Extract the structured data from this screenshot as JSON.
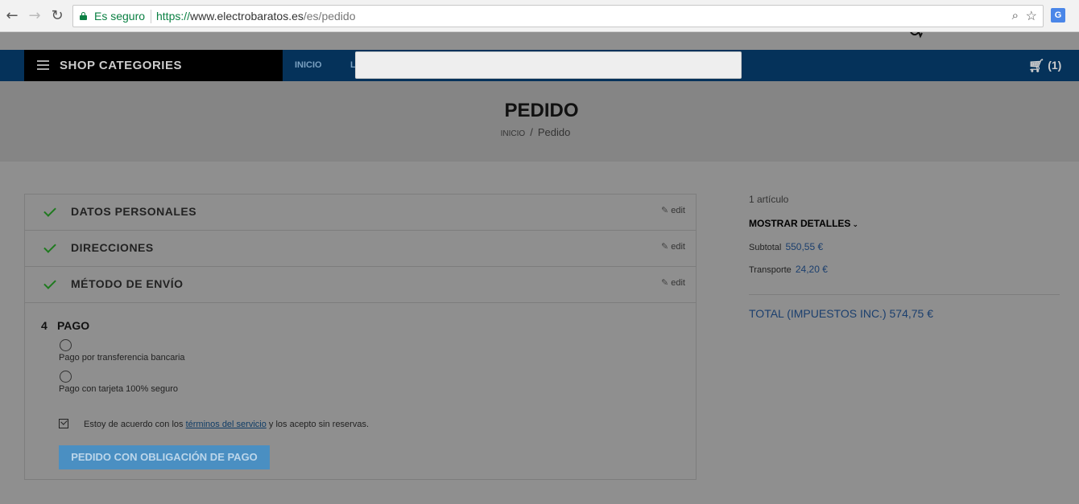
{
  "browser": {
    "secure_label": "Es seguro",
    "url_scheme": "https://",
    "url_host": "www.electrobaratos.es",
    "url_path": "/es/pedido"
  },
  "nav": {
    "shop_categories": "SHOP CATEGORIES",
    "link_inicio": "INICIO",
    "link_l": "L",
    "cart_count": "(1)"
  },
  "page": {
    "title": "PEDIDO",
    "breadcrumb_home": "Inicio",
    "breadcrumb_sep": "/",
    "breadcrumb_current": "Pedido"
  },
  "steps": [
    {
      "title": "DATOS PERSONALES",
      "edit": "edit"
    },
    {
      "title": "DIRECCIONES",
      "edit": "edit"
    },
    {
      "title": "MÉTODO DE ENVÍO",
      "edit": "edit"
    }
  ],
  "payment": {
    "number": "4",
    "title": "PAGO",
    "options": [
      {
        "label": "Pago por transferencia bancaria",
        "selected": false
      },
      {
        "label": "Pago con tarjeta 100% seguro",
        "selected": false
      }
    ],
    "tos_before": "Estoy de acuerdo con los ",
    "tos_link": "términos del servicio",
    "tos_after": " y los acepto sin reservas.",
    "tos_checked": true,
    "order_button": "PEDIDO CON OBLIGACIÓN DE PAGO"
  },
  "summary": {
    "item_count": "1 artículo",
    "show_details": "MOSTRAR DETALLES",
    "subtotal_label": "Subtotal",
    "subtotal_value": "550,55 €",
    "shipping_label": "Transporte",
    "shipping_value": "24,20 €",
    "total": "TOTAL (IMPUESTOS INC.) 574,75 €"
  },
  "colors": {
    "nav_blue": "#05325a",
    "accent_blue": "#4a8fc2",
    "check_green": "#1f7a1f"
  }
}
